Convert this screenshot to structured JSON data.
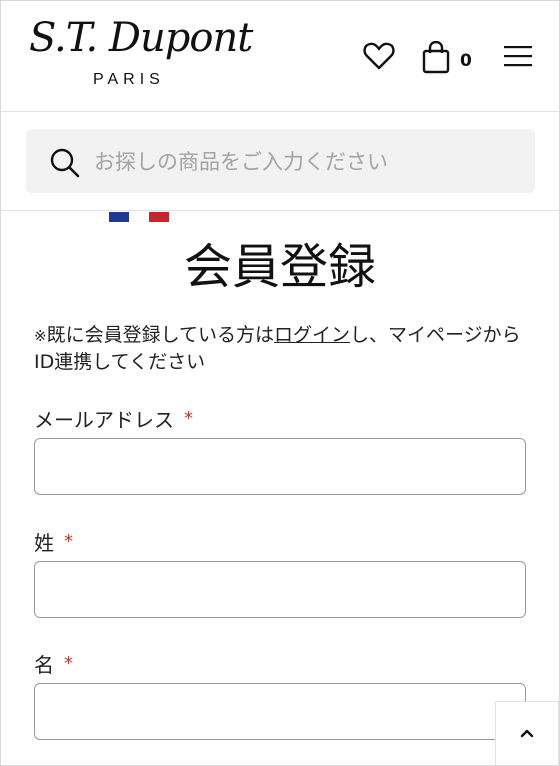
{
  "brand": {
    "name": "S.T. Dupont",
    "sub": "PARIS"
  },
  "header": {
    "cart_count": "0"
  },
  "search": {
    "placeholder": "お探しの商品をご入力ください"
  },
  "main": {
    "title": "会員登録",
    "notice_mark": "※",
    "notice_before": "既に会員登録している方は",
    "notice_link": "ログイン",
    "notice_after": "し、マイページからID連携してください",
    "fields": [
      {
        "label": "メールアドレス",
        "required": "*"
      },
      {
        "label": "姓",
        "required": "*"
      },
      {
        "label": "名",
        "required": "*"
      }
    ]
  },
  "colors": {
    "accent_required": "#c0392b",
    "flag_blue": "#1d3b8f",
    "flag_red": "#c1272d"
  },
  "icons": [
    "heart-icon",
    "bag-icon",
    "menu-icon",
    "search-icon",
    "chevron-up-icon"
  ]
}
